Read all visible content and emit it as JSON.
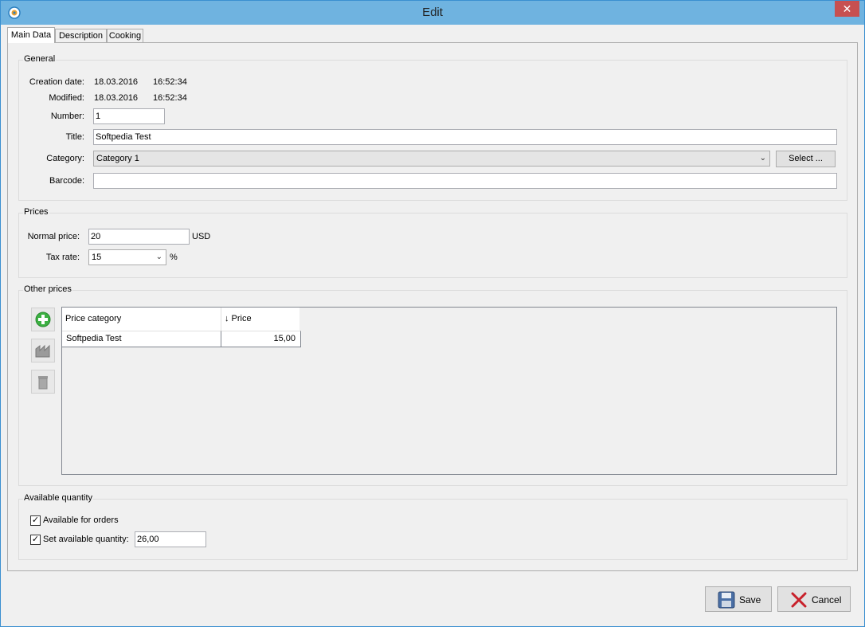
{
  "window": {
    "title": "Edit",
    "close_glyph": "✕"
  },
  "tabs": [
    {
      "label": "Main Data"
    },
    {
      "label": "Description"
    },
    {
      "label": "Cooking"
    }
  ],
  "general": {
    "title": "General",
    "creation_label": "Creation date:",
    "creation_date": "18.03.2016",
    "creation_time": "16:52:34",
    "modified_label": "Modified:",
    "modified_date": "18.03.2016",
    "modified_time": "16:52:34",
    "number_label": "Number:",
    "number_value": "1",
    "title_label": "Title:",
    "title_value": "Softpedia Test",
    "category_label": "Category:",
    "category_value": "Category 1",
    "select_button": "Select ...",
    "barcode_label": "Barcode:",
    "barcode_value": ""
  },
  "prices": {
    "title": "Prices",
    "normal_label": "Normal price:",
    "normal_value": "20",
    "currency": "USD",
    "tax_label": "Tax rate:",
    "tax_value": "15",
    "tax_unit": "%"
  },
  "other_prices": {
    "title": "Other prices",
    "columns": [
      "Price category",
      "↓ Price"
    ],
    "rows": [
      {
        "category": "Softpedia Test",
        "price": "15,00"
      }
    ],
    "tool_icons": [
      "add-icon",
      "edit-icon",
      "delete-icon"
    ]
  },
  "quantity": {
    "title": "Available quantity",
    "available_label": "Available for orders",
    "available_checked": true,
    "set_label": "Set available quantity:",
    "set_checked": true,
    "set_value": "26,00"
  },
  "footer": {
    "save_label": "Save",
    "cancel_label": "Cancel"
  },
  "colors": {
    "titlebar": "#6fb3e0",
    "close": "#c75050",
    "add_green": "#3cb043"
  }
}
